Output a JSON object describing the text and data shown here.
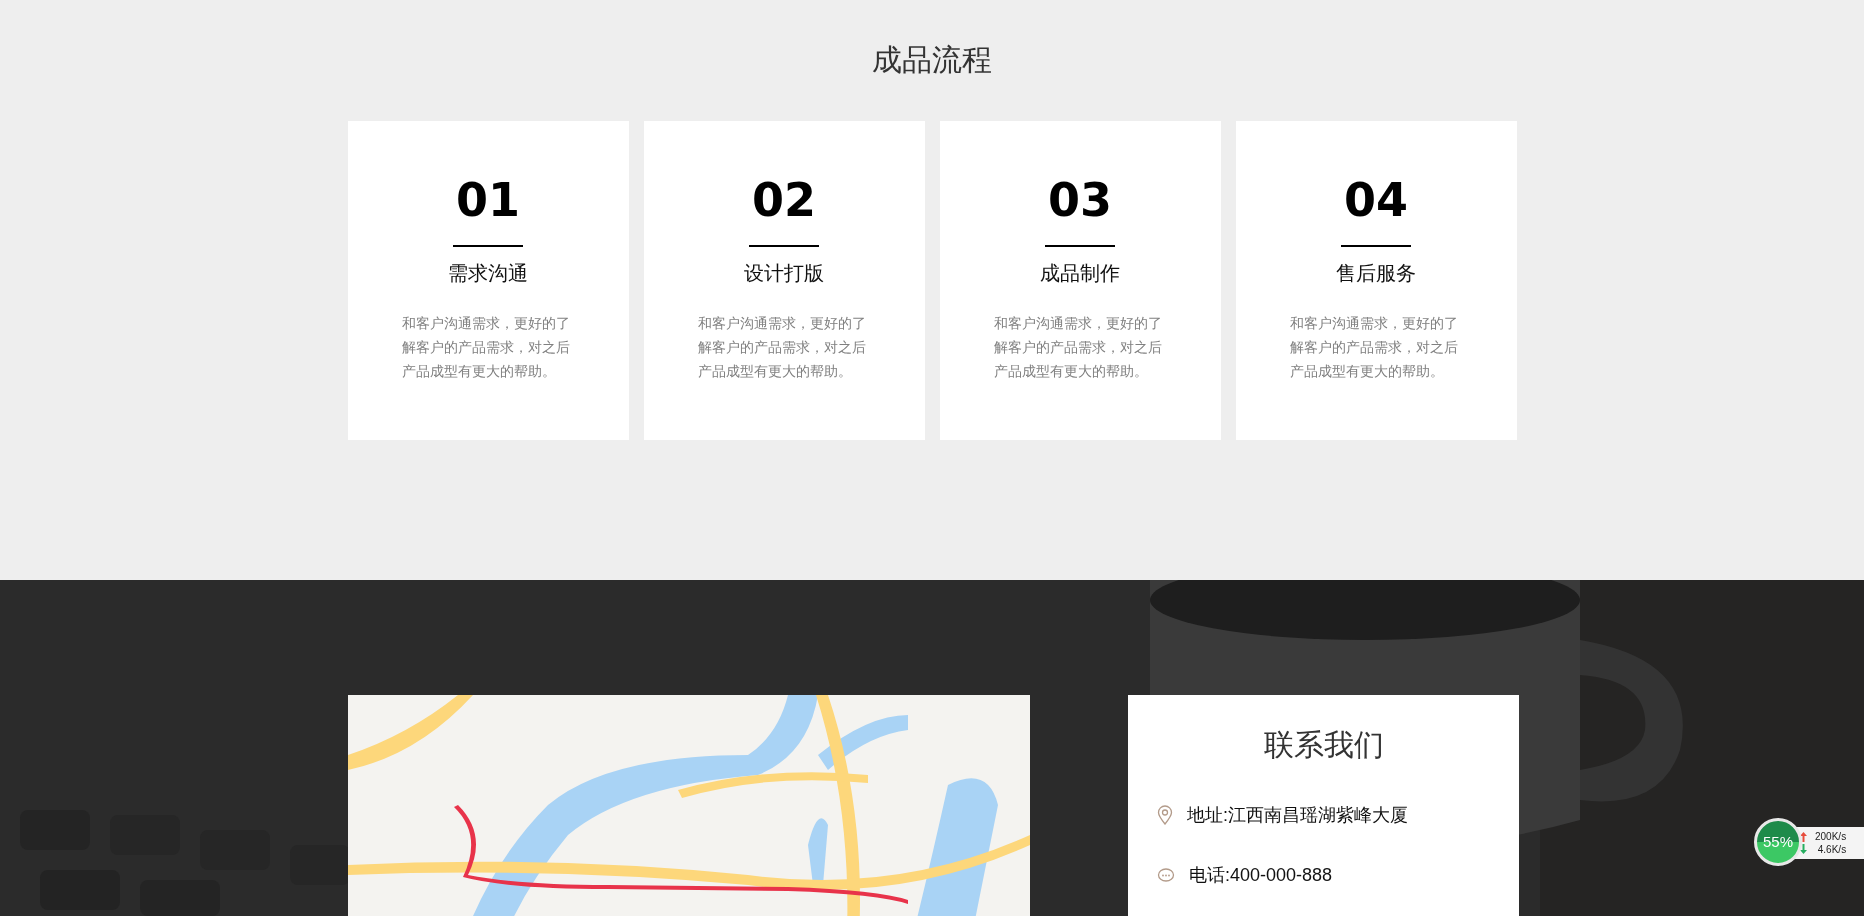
{
  "process": {
    "title": "成品流程",
    "steps": [
      {
        "number": "01",
        "title": "需求沟通",
        "description": "和客户沟通需求，更好的了解客户的产品需求，对之后产品成型有更大的帮助。"
      },
      {
        "number": "02",
        "title": "设计打版",
        "description": "和客户沟通需求，更好的了解客户的产品需求，对之后产品成型有更大的帮助。"
      },
      {
        "number": "03",
        "title": "成品制作",
        "description": "和客户沟通需求，更好的了解客户的产品需求，对之后产品成型有更大的帮助。"
      },
      {
        "number": "04",
        "title": "售后服务",
        "description": "和客户沟通需求，更好的了解客户的产品需求，对之后产品成型有更大的帮助。"
      }
    ]
  },
  "contact": {
    "title": "联系我们",
    "items": [
      {
        "kind": "address",
        "text": "地址:江西南昌瑶湖紫峰大厦"
      },
      {
        "kind": "phone",
        "text": "电话:400-000-888"
      }
    ]
  },
  "speed_widget": {
    "percent": "55%",
    "upload": "200K/s",
    "download": "4.6K/s"
  }
}
